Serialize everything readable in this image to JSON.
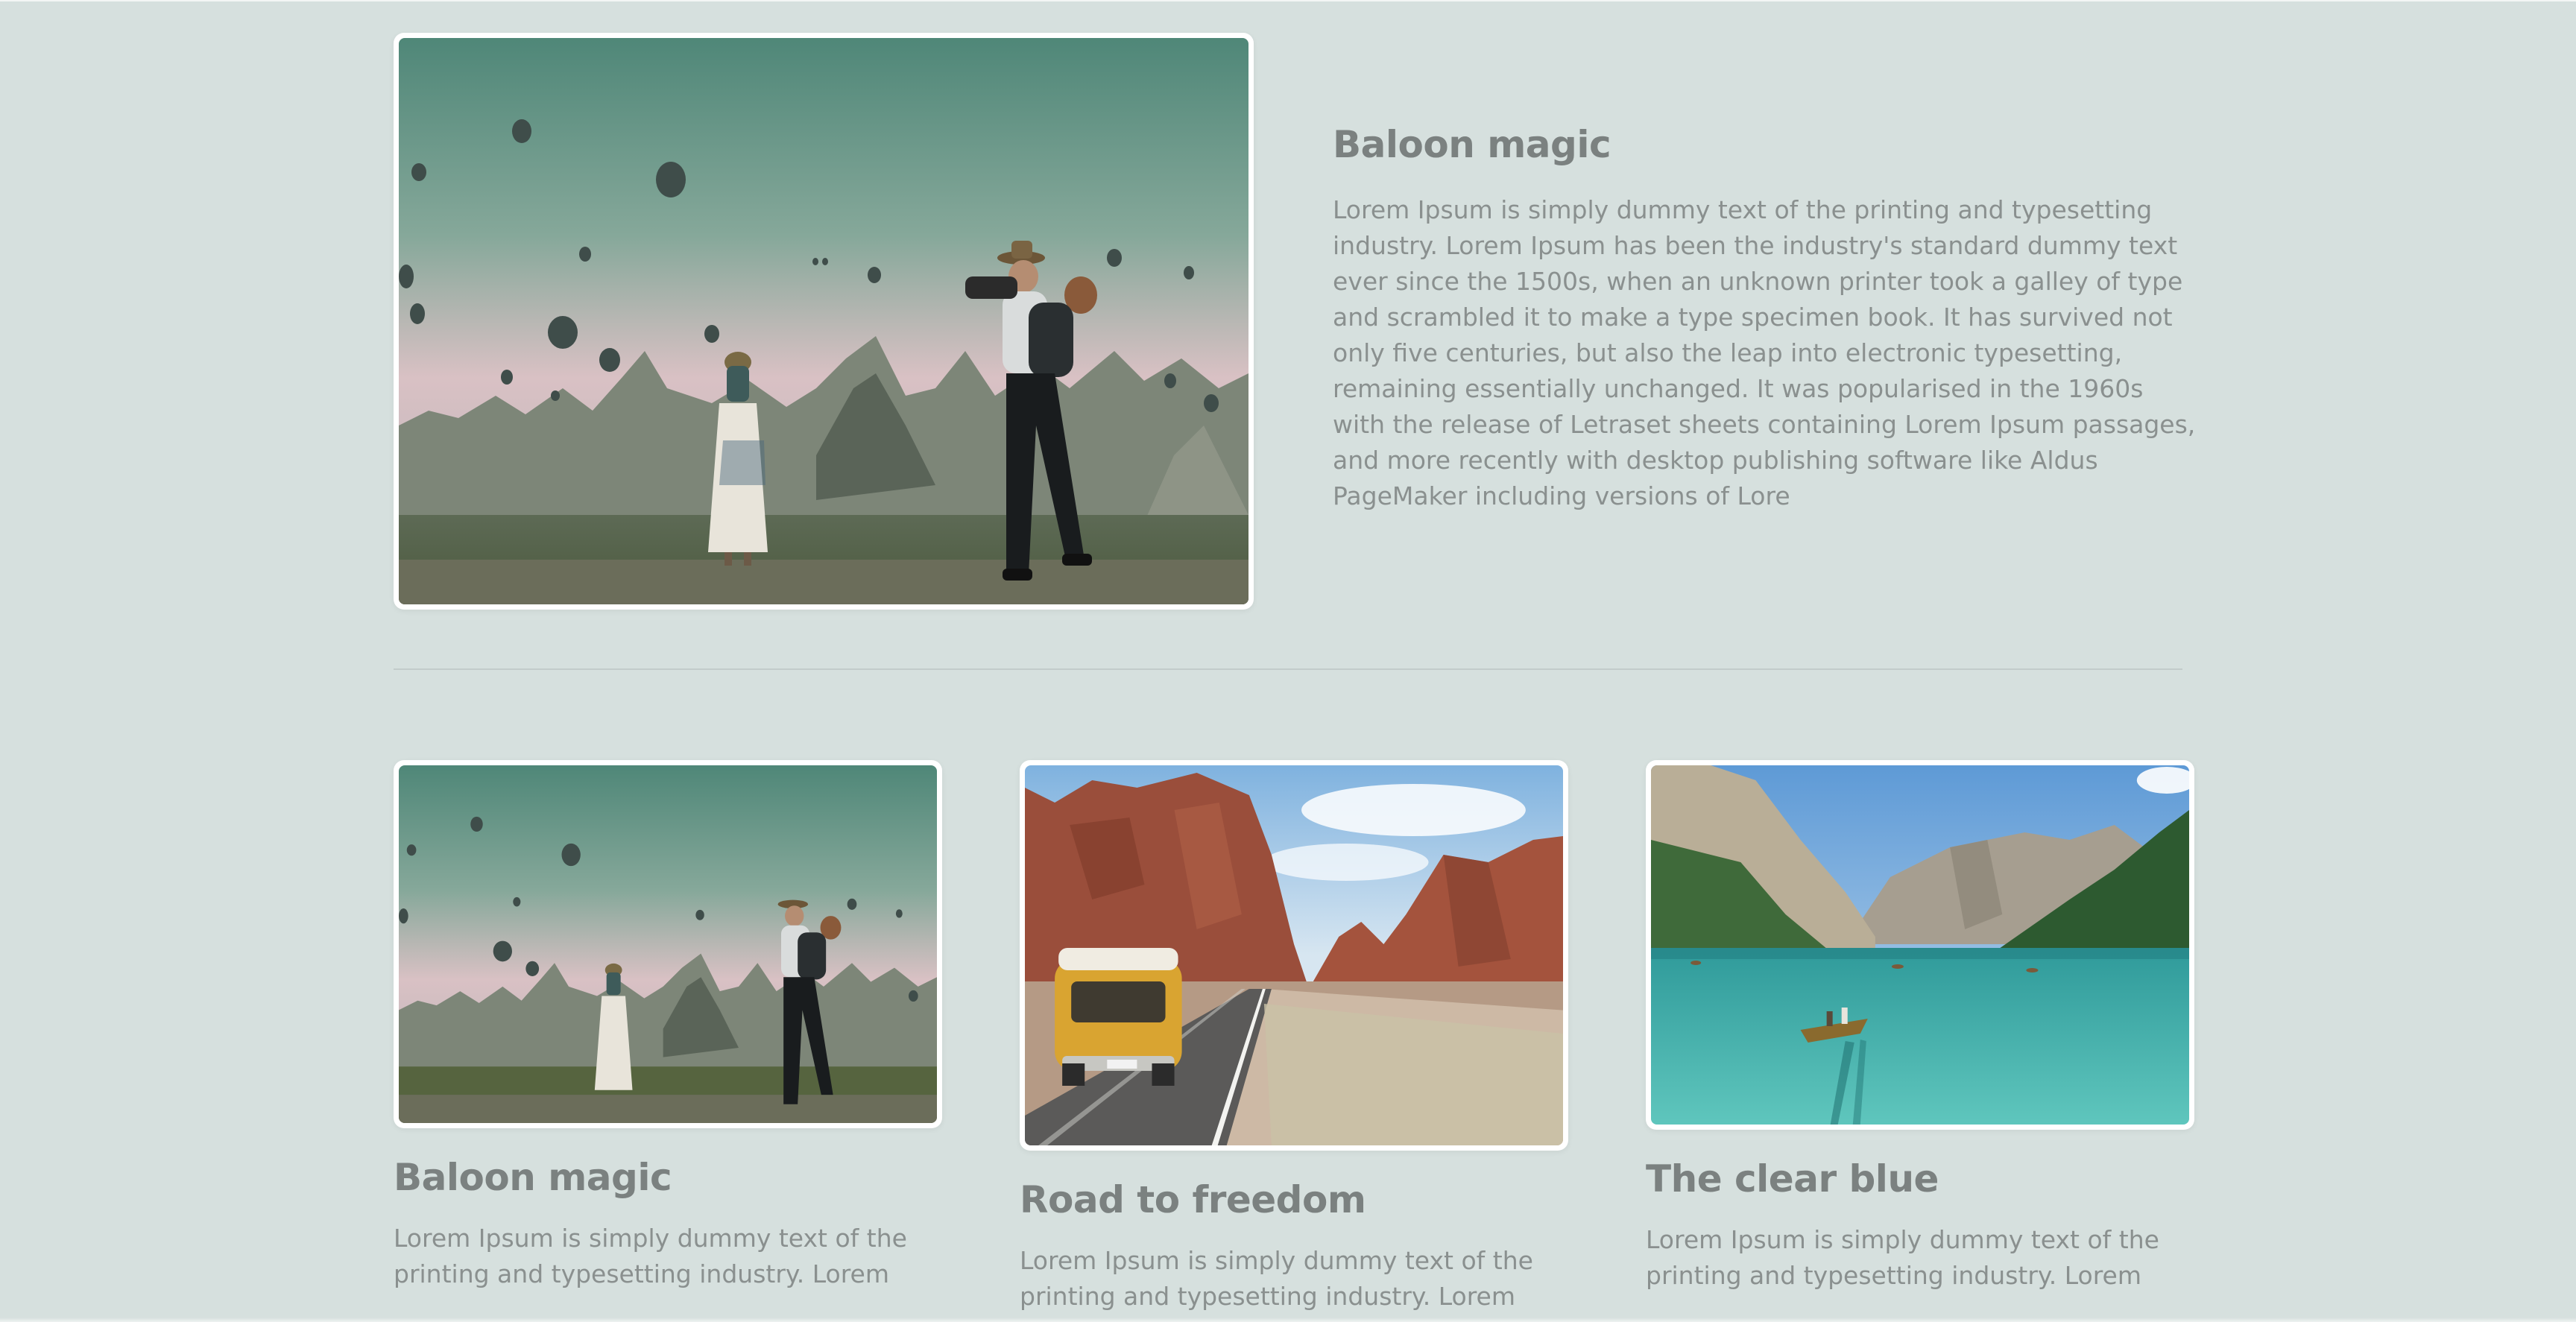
{
  "featured": {
    "title": "Baloon magic",
    "body": "Lorem Ipsum is simply dummy text of the printing and typesetting industry. Lorem Ipsum has been the industry's standard dummy text ever since the 1500s, when an unknown printer took a galley of type and scrambled it to make a type specimen book. It has survived not only five centuries, but also the leap into electronic typesetting, remaining essentially unchanged. It was popularised in the 1960s with the release of Letraset sheets containing Lorem Ipsum passages, and more recently with desktop publishing software like Aldus PageMaker including versions of Lore",
    "image": "balloons-photographers-photo"
  },
  "cards": [
    {
      "title": "Baloon magic",
      "body": "Lorem Ipsum is simply dummy text of the printing and typesetting industry. Lorem",
      "image": "balloons-photographers-photo"
    },
    {
      "title": "Road to freedom",
      "body": "Lorem Ipsum is simply dummy text of the printing and typesetting industry. Lorem",
      "image": "yellow-van-desert-road-photo"
    },
    {
      "title": "The clear blue",
      "body": "Lorem Ipsum is simply dummy text of the printing and typesetting industry. Lorem",
      "image": "turquoise-mountain-lake-photo"
    }
  ],
  "colors": {
    "background": "#d6e0de",
    "heading": "#7b8180",
    "body": "#8a908f",
    "frame": "#ffffff"
  }
}
